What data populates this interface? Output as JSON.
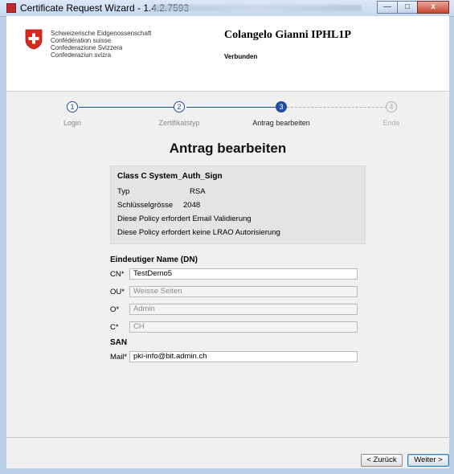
{
  "window": {
    "title": "Certificate Request Wizard - 1.4.2.7593",
    "controls": {
      "minimize": "—",
      "maximize": "□",
      "close": "x"
    }
  },
  "header": {
    "gov_lines": [
      "Schweizerische Eidgenossenschaft",
      "Confédération suisse",
      "Confederazione Svizzera",
      "Confederaziun svizra"
    ],
    "user_name": "Colangelo Gianni IPHL1P",
    "status": "Verbunden"
  },
  "steps": [
    {
      "number": "1",
      "label": "Login",
      "state": "done"
    },
    {
      "number": "2",
      "label": "Zertifikatstyp",
      "state": "done"
    },
    {
      "number": "3",
      "label": "Antrag bearbeiten",
      "state": "current"
    },
    {
      "number": "4",
      "label": "Ende",
      "state": "pending"
    }
  ],
  "page_title": "Antrag bearbeiten",
  "policy": {
    "title": "Class C System_Auth_Sign",
    "typ_label": "Typ",
    "typ_value": "RSA",
    "keysize_label": "Schlüsselgrösse",
    "keysize_value": "2048",
    "note1": "Diese Policy erfordert Email Validierung",
    "note2": "Diese Policy erfordert keine LRAO Autorisierung"
  },
  "dn": {
    "heading": "Eindeutiger Name (DN)",
    "fields": [
      {
        "label": "CN*",
        "value": "TestDemo5",
        "enabled": true
      },
      {
        "label": "OU*",
        "value": "Weisse Seiten",
        "enabled": false
      },
      {
        "label": "O*",
        "value": "Admin",
        "enabled": false
      },
      {
        "label": "C*",
        "value": "CH",
        "enabled": false
      }
    ]
  },
  "san": {
    "heading": "SAN",
    "fields": [
      {
        "label": "Mail*",
        "value": "pki-info@bit.admin.ch",
        "enabled": true
      }
    ]
  },
  "buttons": {
    "back": "< Zurück",
    "next": "Weiter >"
  },
  "colors": {
    "accent": "#1f4e9c",
    "flag_red": "#d52b1e",
    "pending": "#b0b0b0"
  }
}
